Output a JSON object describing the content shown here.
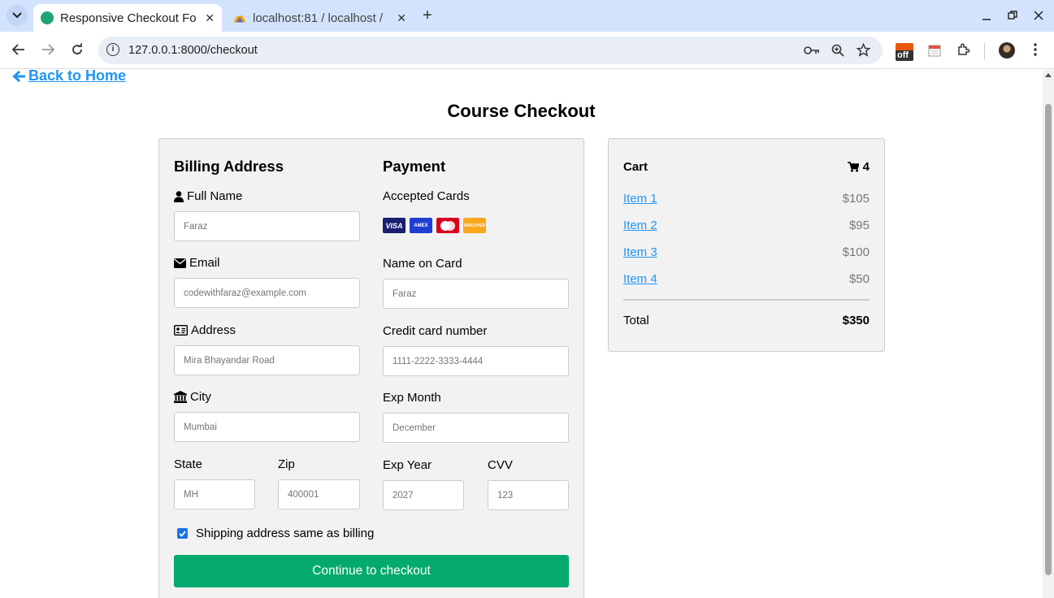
{
  "browser": {
    "tabs": [
      {
        "title": "Responsive Checkout Fo",
        "favicon_color": "#1ea672"
      },
      {
        "title": "localhost:81 / localhost /",
        "favicon_color": "#f0a30a"
      }
    ],
    "new_tab": "+",
    "close": "✕",
    "url": "127.0.0.1:8000/checkout",
    "ext_badge": "off"
  },
  "page": {
    "back_link": "Back to Home",
    "title": "Course Checkout"
  },
  "billing": {
    "heading": "Billing Address",
    "full_name_label": "Full Name",
    "full_name_value": "Faraz",
    "email_label": "Email",
    "email_value": "codewithfaraz@example.com",
    "address_label": "Address",
    "address_value": "Mira Bhayandar Road",
    "city_label": "City",
    "city_value": "Mumbai",
    "state_label": "State",
    "state_value": "MH",
    "zip_label": "Zip",
    "zip_value": "400001"
  },
  "payment": {
    "heading": "Payment",
    "accepted_label": "Accepted Cards",
    "cards": [
      "VISA",
      "AMEX",
      "MC",
      "DISCOVER"
    ],
    "name_on_card_label": "Name on Card",
    "name_on_card_value": "Faraz",
    "cc_label": "Credit card number",
    "cc_value": "1111-2222-3333-4444",
    "exp_month_label": "Exp Month",
    "exp_month_value": "December",
    "exp_year_label": "Exp Year",
    "exp_year_value": "2027",
    "cvv_label": "CVV",
    "cvv_value": "123"
  },
  "shipping_same_label": "Shipping address same as billing",
  "submit_label": "Continue to checkout",
  "cart": {
    "heading": "Cart",
    "count": "4",
    "items": [
      {
        "name": "Item 1",
        "price": "$105"
      },
      {
        "name": "Item 2",
        "price": "$95"
      },
      {
        "name": "Item 3",
        "price": "$100"
      },
      {
        "name": "Item 4",
        "price": "$50"
      }
    ],
    "total_label": "Total",
    "total_value": "$350"
  },
  "colors": {
    "accent": "#04aa6d",
    "link": "#2196f3",
    "chrome": "#d3e3fd"
  }
}
